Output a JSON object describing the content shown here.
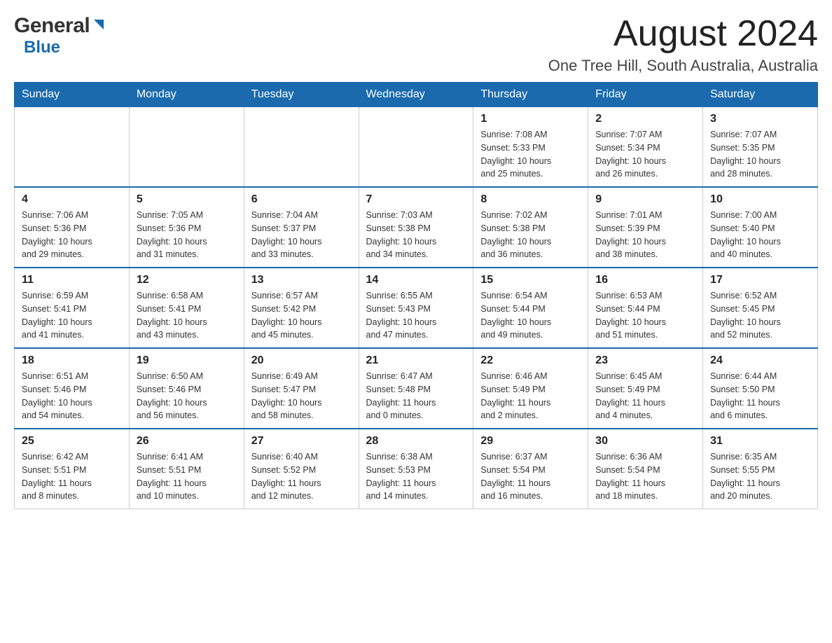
{
  "logo": {
    "general": "General",
    "blue": "Blue"
  },
  "header": {
    "month": "August 2024",
    "location": "One Tree Hill, South Australia, Australia"
  },
  "weekdays": [
    "Sunday",
    "Monday",
    "Tuesday",
    "Wednesday",
    "Thursday",
    "Friday",
    "Saturday"
  ],
  "weeks": [
    [
      {
        "day": "",
        "info": ""
      },
      {
        "day": "",
        "info": ""
      },
      {
        "day": "",
        "info": ""
      },
      {
        "day": "",
        "info": ""
      },
      {
        "day": "1",
        "info": "Sunrise: 7:08 AM\nSunset: 5:33 PM\nDaylight: 10 hours\nand 25 minutes."
      },
      {
        "day": "2",
        "info": "Sunrise: 7:07 AM\nSunset: 5:34 PM\nDaylight: 10 hours\nand 26 minutes."
      },
      {
        "day": "3",
        "info": "Sunrise: 7:07 AM\nSunset: 5:35 PM\nDaylight: 10 hours\nand 28 minutes."
      }
    ],
    [
      {
        "day": "4",
        "info": "Sunrise: 7:06 AM\nSunset: 5:36 PM\nDaylight: 10 hours\nand 29 minutes."
      },
      {
        "day": "5",
        "info": "Sunrise: 7:05 AM\nSunset: 5:36 PM\nDaylight: 10 hours\nand 31 minutes."
      },
      {
        "day": "6",
        "info": "Sunrise: 7:04 AM\nSunset: 5:37 PM\nDaylight: 10 hours\nand 33 minutes."
      },
      {
        "day": "7",
        "info": "Sunrise: 7:03 AM\nSunset: 5:38 PM\nDaylight: 10 hours\nand 34 minutes."
      },
      {
        "day": "8",
        "info": "Sunrise: 7:02 AM\nSunset: 5:38 PM\nDaylight: 10 hours\nand 36 minutes."
      },
      {
        "day": "9",
        "info": "Sunrise: 7:01 AM\nSunset: 5:39 PM\nDaylight: 10 hours\nand 38 minutes."
      },
      {
        "day": "10",
        "info": "Sunrise: 7:00 AM\nSunset: 5:40 PM\nDaylight: 10 hours\nand 40 minutes."
      }
    ],
    [
      {
        "day": "11",
        "info": "Sunrise: 6:59 AM\nSunset: 5:41 PM\nDaylight: 10 hours\nand 41 minutes."
      },
      {
        "day": "12",
        "info": "Sunrise: 6:58 AM\nSunset: 5:41 PM\nDaylight: 10 hours\nand 43 minutes."
      },
      {
        "day": "13",
        "info": "Sunrise: 6:57 AM\nSunset: 5:42 PM\nDaylight: 10 hours\nand 45 minutes."
      },
      {
        "day": "14",
        "info": "Sunrise: 6:55 AM\nSunset: 5:43 PM\nDaylight: 10 hours\nand 47 minutes."
      },
      {
        "day": "15",
        "info": "Sunrise: 6:54 AM\nSunset: 5:44 PM\nDaylight: 10 hours\nand 49 minutes."
      },
      {
        "day": "16",
        "info": "Sunrise: 6:53 AM\nSunset: 5:44 PM\nDaylight: 10 hours\nand 51 minutes."
      },
      {
        "day": "17",
        "info": "Sunrise: 6:52 AM\nSunset: 5:45 PM\nDaylight: 10 hours\nand 52 minutes."
      }
    ],
    [
      {
        "day": "18",
        "info": "Sunrise: 6:51 AM\nSunset: 5:46 PM\nDaylight: 10 hours\nand 54 minutes."
      },
      {
        "day": "19",
        "info": "Sunrise: 6:50 AM\nSunset: 5:46 PM\nDaylight: 10 hours\nand 56 minutes."
      },
      {
        "day": "20",
        "info": "Sunrise: 6:49 AM\nSunset: 5:47 PM\nDaylight: 10 hours\nand 58 minutes."
      },
      {
        "day": "21",
        "info": "Sunrise: 6:47 AM\nSunset: 5:48 PM\nDaylight: 11 hours\nand 0 minutes."
      },
      {
        "day": "22",
        "info": "Sunrise: 6:46 AM\nSunset: 5:49 PM\nDaylight: 11 hours\nand 2 minutes."
      },
      {
        "day": "23",
        "info": "Sunrise: 6:45 AM\nSunset: 5:49 PM\nDaylight: 11 hours\nand 4 minutes."
      },
      {
        "day": "24",
        "info": "Sunrise: 6:44 AM\nSunset: 5:50 PM\nDaylight: 11 hours\nand 6 minutes."
      }
    ],
    [
      {
        "day": "25",
        "info": "Sunrise: 6:42 AM\nSunset: 5:51 PM\nDaylight: 11 hours\nand 8 minutes."
      },
      {
        "day": "26",
        "info": "Sunrise: 6:41 AM\nSunset: 5:51 PM\nDaylight: 11 hours\nand 10 minutes."
      },
      {
        "day": "27",
        "info": "Sunrise: 6:40 AM\nSunset: 5:52 PM\nDaylight: 11 hours\nand 12 minutes."
      },
      {
        "day": "28",
        "info": "Sunrise: 6:38 AM\nSunset: 5:53 PM\nDaylight: 11 hours\nand 14 minutes."
      },
      {
        "day": "29",
        "info": "Sunrise: 6:37 AM\nSunset: 5:54 PM\nDaylight: 11 hours\nand 16 minutes."
      },
      {
        "day": "30",
        "info": "Sunrise: 6:36 AM\nSunset: 5:54 PM\nDaylight: 11 hours\nand 18 minutes."
      },
      {
        "day": "31",
        "info": "Sunrise: 6:35 AM\nSunset: 5:55 PM\nDaylight: 11 hours\nand 20 minutes."
      }
    ]
  ]
}
